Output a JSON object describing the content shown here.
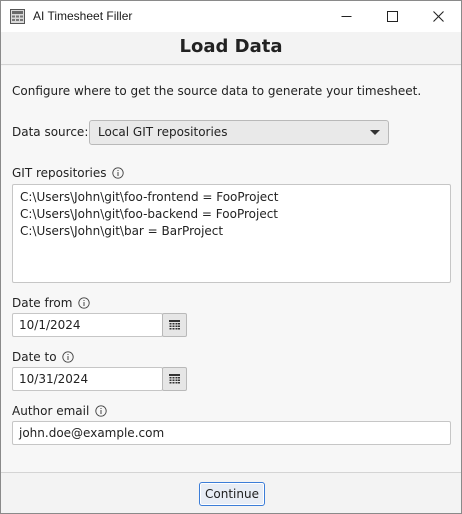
{
  "window": {
    "title": "AI Timesheet Filler"
  },
  "header": {
    "title": "Load Data"
  },
  "form": {
    "intro": "Configure where to get the source data to generate your timesheet.",
    "data_source": {
      "label": "Data source:",
      "value": "Local GIT repositories"
    },
    "git_repositories": {
      "label": "GIT repositories",
      "lines": [
        "C:\\Users\\John\\git\\foo-frontend = FooProject",
        "C:\\Users\\John\\git\\foo-backend = FooProject",
        "C:\\Users\\John\\git\\bar = BarProject"
      ]
    },
    "date_from": {
      "label": "Date from",
      "value": "10/1/2024"
    },
    "date_to": {
      "label": "Date to",
      "value": "10/31/2024"
    },
    "author_email": {
      "label": "Author email",
      "value": "john.doe@example.com"
    }
  },
  "footer": {
    "continue_label": "Continue"
  },
  "icons": {
    "app": "timesheet-app-icon",
    "info": "info-icon",
    "calendar": "calendar-icon",
    "dropdown": "chevron-down-icon"
  },
  "colors": {
    "accent_border": "#3b7dd8",
    "window_bg": "#f3f3f3",
    "field_bg": "#ffffff"
  }
}
